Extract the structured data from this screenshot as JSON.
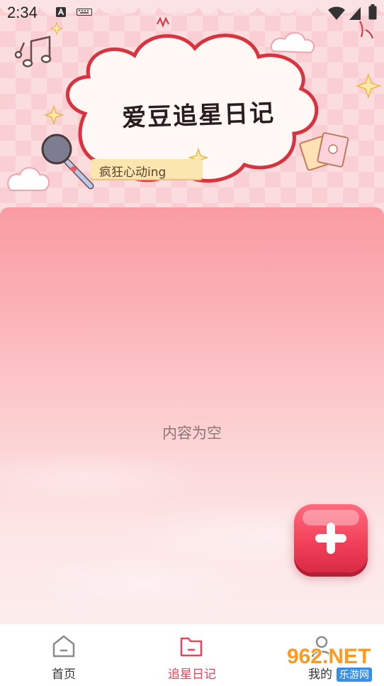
{
  "status_bar": {
    "time": "2:34",
    "icons": [
      "a-notification-icon",
      "keyboard-icon",
      "wifi-icon",
      "signal-icon",
      "battery-icon"
    ]
  },
  "banner": {
    "title": "爱豆追星日记",
    "subtitle": "疯狂心动ing"
  },
  "content": {
    "empty_text": "内容为空"
  },
  "fab": {
    "icon": "plus-icon",
    "color": "#f2425b"
  },
  "bottom_nav": {
    "items": [
      {
        "label": "首页",
        "icon": "home-icon",
        "active": false
      },
      {
        "label": "追星日记",
        "icon": "folder-icon",
        "active": true
      },
      {
        "label": "我的",
        "icon": "profile-icon",
        "active": false
      }
    ],
    "active_color": "#e8455a",
    "inactive_color": "#333333"
  },
  "watermark": {
    "main": "962.NET",
    "sub": "乐游网"
  }
}
